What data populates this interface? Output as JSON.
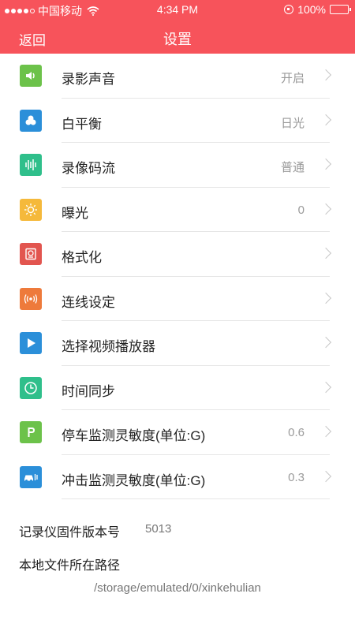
{
  "status_bar": {
    "carrier": "中国移动",
    "time": "4:34 PM",
    "battery": "100%"
  },
  "nav": {
    "back": "返回",
    "title": "设置"
  },
  "settings": [
    {
      "label": "录影声音",
      "value": "开启",
      "icon": "speaker-icon",
      "color": "#6cc24a"
    },
    {
      "label": "白平衡",
      "value": "日光",
      "icon": "color-circles-icon",
      "color": "#2b8fd9"
    },
    {
      "label": "录像码流",
      "value": "普通",
      "icon": "bitrate-icon",
      "color": "#2fbf8b"
    },
    {
      "label": "曝光",
      "value": "0",
      "icon": "sun-icon",
      "color": "#f5b93b"
    },
    {
      "label": "格式化",
      "value": "",
      "icon": "format-icon",
      "color": "#e2554f"
    },
    {
      "label": "连线设定",
      "value": "",
      "icon": "connection-icon",
      "color": "#ee7a3b"
    },
    {
      "label": "选择视频播放器",
      "value": "",
      "icon": "play-icon",
      "color": "#2b8fd9"
    },
    {
      "label": "时间同步",
      "value": "",
      "icon": "clock-icon",
      "color": "#2fbf8b"
    },
    {
      "label": "停车监测灵敏度(单位:G)",
      "value": "0.6",
      "icon": "parking-icon",
      "color": "#6cc24a"
    },
    {
      "label": "冲击监测灵敏度(单位:G)",
      "value": "0.3",
      "icon": "car-crash-icon",
      "color": "#2b8fd9"
    }
  ],
  "firmware": {
    "label": "记录仪固件版本号",
    "value": "5013"
  },
  "local_path": {
    "label": "本地文件所在路径",
    "value": "/storage/emulated/0/xinkehulian"
  }
}
